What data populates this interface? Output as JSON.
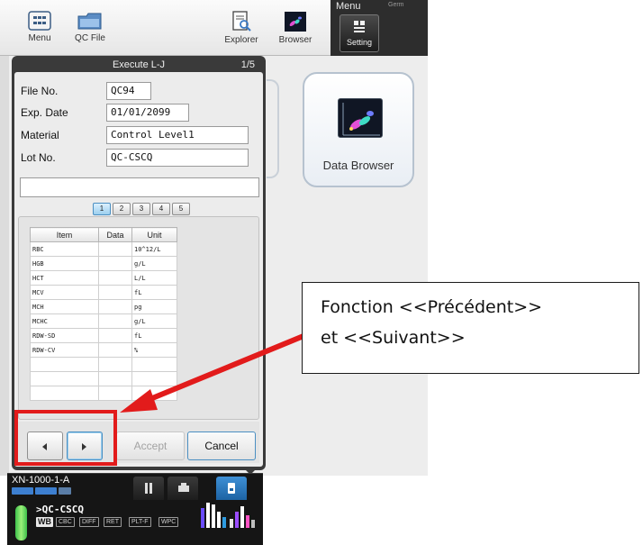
{
  "toolbar": {
    "menu_label": "Menu",
    "qc_file_label": "QC File",
    "explorer_label": "Explorer",
    "browser_label": "Browser",
    "menu_panel_title": "Menu",
    "lang_text": "Germ",
    "setting_label": "Setting"
  },
  "tile": {
    "label": "Data Browser"
  },
  "dialog": {
    "title": "Execute L-J",
    "page": "1/5",
    "fields": {
      "file_no_label": "File No.",
      "file_no_value": "QC94",
      "exp_date_label": "Exp. Date",
      "exp_date_value": "01/01/2099",
      "material_label": "Material",
      "material_value": "Control Level1",
      "lot_no_label": "Lot No.",
      "lot_no_value": "QC-CSCQ"
    },
    "pages": [
      "1",
      "2",
      "3",
      "4",
      "5"
    ],
    "table": {
      "headers": [
        "Item",
        "Data",
        "Unit"
      ],
      "rows": [
        [
          "RBC",
          "",
          "10^12/L"
        ],
        [
          "HGB",
          "",
          "g/L"
        ],
        [
          "HCT",
          "",
          "L/L"
        ],
        [
          "MCV",
          "",
          "fL"
        ],
        [
          "MCH",
          "",
          "pg"
        ],
        [
          "MCHC",
          "",
          "g/L"
        ],
        [
          "RDW-SD",
          "",
          "fL"
        ],
        [
          "RDW-CV",
          "",
          "%"
        ],
        [
          "",
          "",
          ""
        ],
        [
          "",
          "",
          ""
        ],
        [
          "",
          "",
          ""
        ]
      ]
    },
    "accept_label": "Accept",
    "cancel_label": "Cancel"
  },
  "analyzer": {
    "name": "XN-1000-1-A",
    "sample_id": ">QC-CSCQ",
    "mode": "WB",
    "disciplines": [
      "CBC",
      "DIFF",
      "RET",
      "PLT-F",
      "WPC"
    ],
    "status_color": "#3cc04a"
  },
  "callout": {
    "line1": "Fonction <<Précédent>>",
    "line2": "et <<Suivant>>"
  },
  "colors": {
    "accent": "#1d63a3",
    "highlight": "#e21b1b"
  }
}
